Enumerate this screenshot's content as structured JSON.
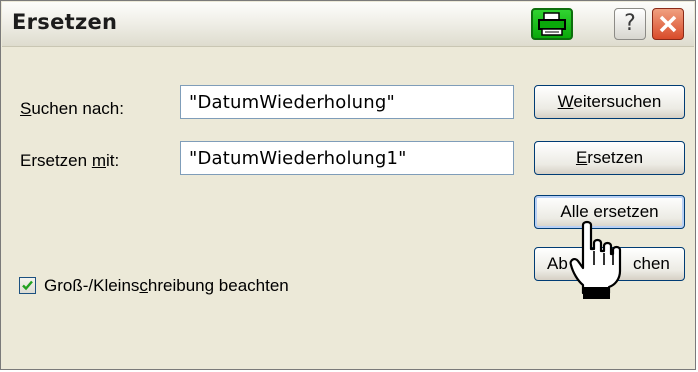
{
  "window": {
    "title": "Ersetzen"
  },
  "titlebar_buttons": {
    "help_glyph": "?",
    "printer_icon": "printer-icon",
    "close_icon": "close-icon"
  },
  "form": {
    "search_label_prefix": "S",
    "search_label_rest": "uchen nach:",
    "search_value": "\"DatumWiederholung\"",
    "replace_label_prefix": "Ersetzen ",
    "replace_label_accel": "m",
    "replace_label_rest": "it:",
    "replace_value": "\"DatumWiederholung1\"",
    "case_label_prefix": "Groß-/Kleins",
    "case_label_accel": "c",
    "case_label_rest": "hreibung beachten",
    "case_checked": true
  },
  "buttons": {
    "find_next_accel": "W",
    "find_next_rest": "eitersuchen",
    "replace_accel": "E",
    "replace_rest": "rsetzen",
    "replace_all_label": "Alle ersetzen",
    "cancel_visible": "Ab",
    "cancel_visible_end": "chen"
  },
  "colors": {
    "dialog_bg": "#ece9d8",
    "accent_green": "#0aa80a",
    "close_red": "#d94b2a"
  }
}
